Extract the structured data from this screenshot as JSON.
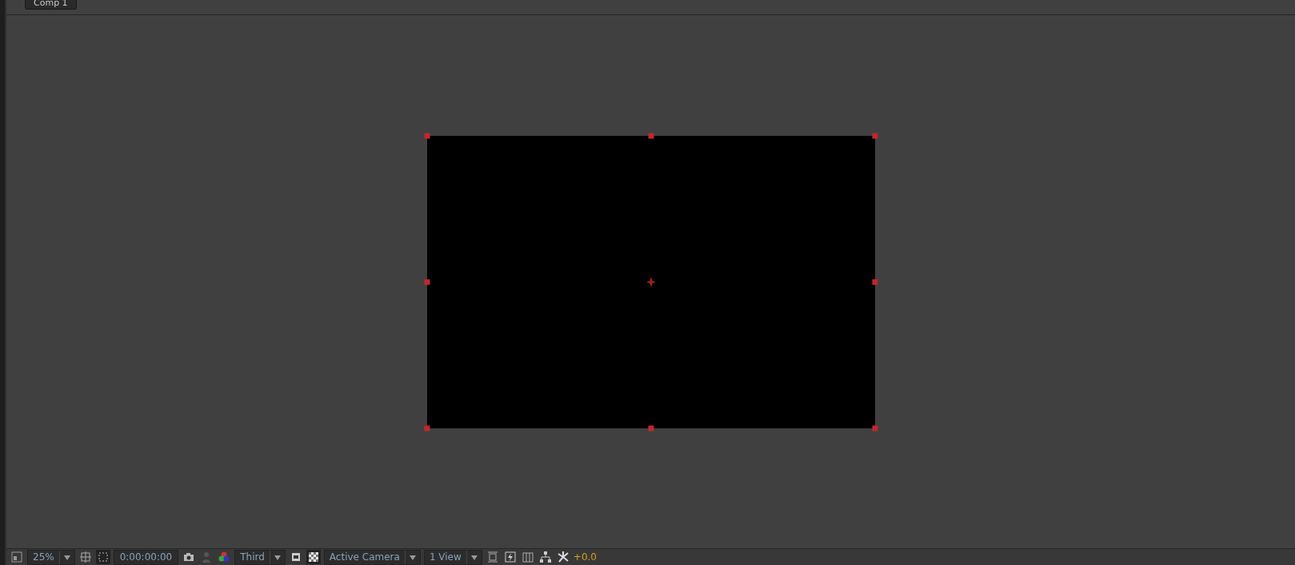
{
  "tabs": [
    {
      "label": "Comp 1",
      "selected": true
    }
  ],
  "canvas": {
    "kind": "composition"
  },
  "toolbar": [
    {
      "kind": "icon"
    },
    {
      "kind": "dropdown",
      "label": "25%"
    },
    {
      "kind": "icon"
    },
    {
      "kind": "icon",
      "on": true
    },
    {
      "kind": "field",
      "label": "0:00:00:00"
    },
    {
      "kind": "icon"
    },
    {
      "kind": "icon"
    },
    {
      "kind": "icon"
    },
    {
      "kind": "dropdown",
      "label": "Third"
    },
    {
      "kind": "icon"
    },
    {
      "kind": "icon",
      "on": true
    },
    {
      "kind": "dropdown",
      "label": "Active Camera"
    },
    {
      "kind": "dropdown",
      "label": "1 View"
    },
    {
      "kind": "icon"
    },
    {
      "kind": "icon"
    },
    {
      "kind": "icon"
    },
    {
      "kind": "icon"
    },
    {
      "kind": "icon"
    },
    {
      "kind": "exposure",
      "label": "+0.0"
    }
  ]
}
